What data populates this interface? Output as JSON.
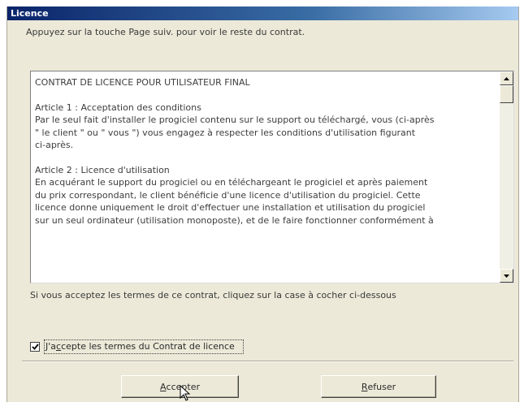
{
  "window": {
    "title": "Licence"
  },
  "instruction": "Appuyez sur la touche Page suiv. pour voir le reste du contrat.",
  "license_text": {
    "heading": "CONTRAT DE LICENCE POUR UTILISATEUR FINAL",
    "article1_title": "Article 1 : Acceptation des conditions",
    "article1_lines": [
      "Par le seul fait d'installer le progiciel contenu sur le support ou téléchargé, vous (ci-après",
      "\" le client \" ou \" vous \") vous engagez à respecter les conditions d'utilisation figurant",
      "ci-après."
    ],
    "article2_title": "Article 2 : Licence d'utilisation",
    "article2_lines": [
      "En acquérant le support du progiciel ou en téléchargeant le progiciel et après paiement",
      "du prix correspondant, le client bénéficie d'une licence d'utilisation du progiciel. Cette",
      "licence donne uniquement le droit d'effectuer une installation et utilisation du progiciel",
      "sur un seul ordinateur (utilisation monoposte), et de le faire fonctionner conformément à"
    ]
  },
  "accept_hint": "Si vous acceptez les termes de ce contrat, cliquez sur la case à cocher ci-dessous",
  "checkbox": {
    "checked": true,
    "label_prefix": "J'a",
    "label_underlined": "c",
    "label_suffix": "cepte les termes du Contrat de licence"
  },
  "buttons": {
    "accept": {
      "underlined": "A",
      "rest": "ccepter"
    },
    "refuse": {
      "underlined": "R",
      "rest": "efuser"
    }
  }
}
